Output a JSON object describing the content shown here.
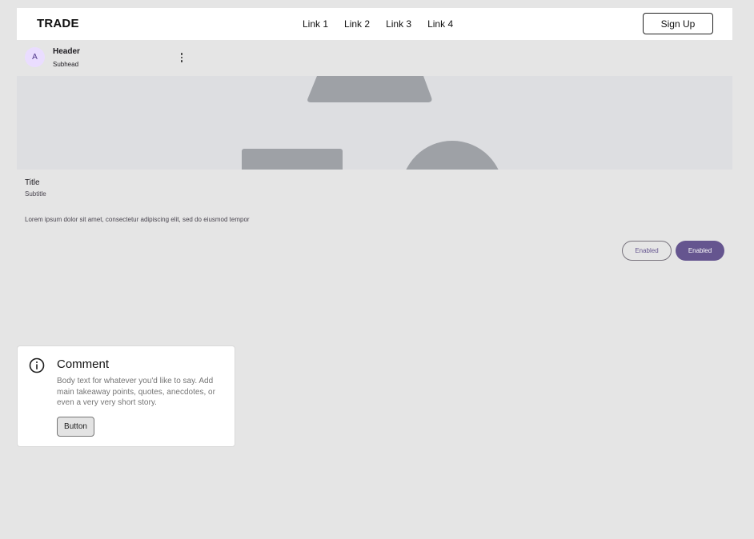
{
  "navbar": {
    "brand": "TRADE",
    "links": [
      "Link 1",
      "Link 2",
      "Link 3",
      "Link 4"
    ],
    "signup_label": "Sign Up"
  },
  "card": {
    "avatar_letter": "A",
    "header": "Header",
    "subhead": "Subhead",
    "menu_icon": "more-vert-icon",
    "title": "Title",
    "subtitle": "Subtitle",
    "body": "Lorem ipsum dolor sit amet, consectetur adipiscing elit, sed do eiusmod tempor",
    "outlined_button": "Enabled",
    "filled_button": "Enabled"
  },
  "comment": {
    "icon": "info-icon",
    "title": "Comment",
    "body": "Body text for whatever you'd like to say. Add main takeaway points, quotes, anecdotes, or even a very very short story.",
    "button_label": "Button"
  },
  "colors": {
    "primary": "#65558f",
    "avatar_bg": "#eaddff",
    "media_bg": "#dddee1",
    "media_shape": "#9ea1a6",
    "page_bg": "#e5e5e5"
  }
}
